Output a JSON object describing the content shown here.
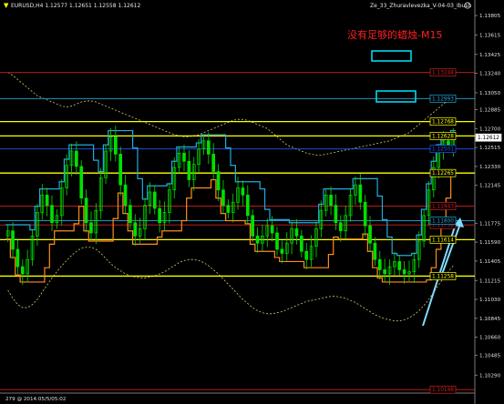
{
  "header": {
    "symbol_label": "EURUSD,H4  1.12577 1.12651 1.12558 1.12612",
    "indicator_label": "Ze_33_Zhuravlevezka_V-04-03_Ibush",
    "subtitle": "没有足够的蜡烛-M15",
    "bottom_label": "279 @ 2014.05/5/05:02"
  },
  "colors": {
    "background": "#000000",
    "candle": "#00e000",
    "red_line": "#d02020",
    "yellow_line": "#ffff00",
    "cyan_line": "#22aadd",
    "orange_line": "#ff8c1a",
    "envelope": "#cccc66",
    "arrow": "#7fdcff",
    "box": "#00e5ff"
  },
  "chart_data": {
    "type": "candlestick",
    "symbol": "EURUSD",
    "timeframe": "H4",
    "last": {
      "open": 1.12577,
      "high": 1.12651,
      "low": 1.12558,
      "close": 1.12612
    },
    "ylim": [
      1.1015,
      1.1385
    ],
    "y_ticks": [
      1.13805,
      1.13615,
      1.13425,
      1.1324,
      1.1305,
      1.12885,
      1.127,
      1.12515,
      1.1233,
      1.12145,
      1.11775,
      1.1159,
      1.11405,
      1.11215,
      1.1103,
      1.10845,
      1.1066,
      1.10485,
      1.1029
    ],
    "levels": [
      {
        "label": "1.13248",
        "value": 1.13248,
        "color": "#d02020",
        "style": "solid"
      },
      {
        "label": "1.12993",
        "value": 1.12993,
        "color": "#22aadd",
        "style": "solid"
      },
      {
        "label": "1.12768",
        "value": 1.12768,
        "color": "#ffff00",
        "style": "solid"
      },
      {
        "label": "1.12628",
        "value": 1.12628,
        "color": "#ffff00",
        "style": "solid"
      },
      {
        "label": "1.12612",
        "value": 1.12612,
        "color": "#ffffff",
        "style": "current"
      },
      {
        "label": "1.12501",
        "value": 1.12501,
        "color": "#2255ff",
        "style": "solid"
      },
      {
        "label": "1.12265",
        "value": 1.12265,
        "color": "#ffff00",
        "style": "solid"
      },
      {
        "label": "1.11943",
        "value": 1.11943,
        "color": "#d02020",
        "style": "solid"
      },
      {
        "label": "1.11758",
        "value": 1.11758,
        "color": "#d02020",
        "style": "solid"
      },
      {
        "label": "1.11614",
        "value": 1.11614,
        "color": "#ffff00",
        "style": "solid"
      },
      {
        "label": "1.11800",
        "value": 1.118,
        "color": "#22aadd",
        "style": "solid"
      },
      {
        "label": "1.11258",
        "value": 1.11258,
        "color": "#ffff00",
        "style": "solid"
      },
      {
        "label": "1.10148",
        "value": 1.10148,
        "color": "#d02020",
        "style": "solid"
      }
    ],
    "closes": [
      1.117,
      1.1152,
      1.1135,
      1.1128,
      1.1142,
      1.1165,
      1.1188,
      1.1205,
      1.1195,
      1.1178,
      1.1185,
      1.1212,
      1.1234,
      1.1248,
      1.1233,
      1.1202,
      1.1178,
      1.1168,
      1.119,
      1.1222,
      1.1248,
      1.1262,
      1.1245,
      1.1215,
      1.1195,
      1.1178,
      1.1165,
      1.1172,
      1.1195,
      1.1208,
      1.1192,
      1.1178,
      1.1188,
      1.121,
      1.1232,
      1.1246,
      1.1238,
      1.122,
      1.1235,
      1.125,
      1.1258,
      1.1245,
      1.1228,
      1.121,
      1.1195,
      1.1188,
      1.1198,
      1.1212,
      1.1205,
      1.1185,
      1.1165,
      1.1158,
      1.1165,
      1.1175,
      1.1168,
      1.1152,
      1.1148,
      1.1158,
      1.1172,
      1.1165,
      1.115,
      1.1142,
      1.1155,
      1.1172,
      1.119,
      1.1205,
      1.1195,
      1.1178,
      1.117,
      1.1185,
      1.1205,
      1.1215,
      1.1198,
      1.1175,
      1.1158,
      1.1142,
      1.1132,
      1.1128,
      1.1135,
      1.114,
      1.1132,
      1.1128,
      1.113,
      1.1142,
      1.116,
      1.1185,
      1.121,
      1.1232,
      1.1248,
      1.1258,
      1.1252,
      1.1262
    ],
    "upper_envelope": [
      1.1325,
      1.1322,
      1.1318,
      1.1314,
      1.131,
      1.1306,
      1.1302,
      1.13,
      1.1298,
      1.1296,
      1.1294,
      1.1292,
      1.1291,
      1.1292,
      1.1294,
      1.1296,
      1.1297,
      1.1297,
      1.1296,
      1.1294,
      1.1292,
      1.129,
      1.1288,
      1.1286,
      1.1284,
      1.1282,
      1.128,
      1.1278,
      1.1276,
      1.1274,
      1.1272,
      1.127,
      1.1268,
      1.1266,
      1.1264,
      1.1263,
      1.1262,
      1.1262,
      1.1263,
      1.1264,
      1.1266,
      1.1268,
      1.127,
      1.1272,
      1.1274,
      1.1276,
      1.1278,
      1.1279,
      1.1279,
      1.1278,
      1.1276,
      1.1274,
      1.1272,
      1.127,
      1.1266,
      1.1262,
      1.1258,
      1.1254,
      1.1252,
      1.125,
      1.1248,
      1.1246,
      1.1245,
      1.1244,
      1.1244,
      1.1245,
      1.1246,
      1.1247,
      1.1248,
      1.1249,
      1.125,
      1.1251,
      1.1252,
      1.1253,
      1.1254,
      1.1255,
      1.1256,
      1.1257,
      1.1258,
      1.126,
      1.1262,
      1.1264,
      1.1266,
      1.127,
      1.1274,
      1.1278,
      1.1282,
      1.1286,
      1.129,
      1.1294,
      1.1298,
      1.1302
    ],
    "lower_envelope": [
      1.1112,
      1.1104,
      1.1098,
      1.1095,
      1.1095,
      1.1098,
      1.1103,
      1.111,
      1.1117,
      1.1124,
      1.113,
      1.1136,
      1.1141,
      1.1146,
      1.115,
      1.1153,
      1.1154,
      1.1154,
      1.1152,
      1.1148,
      1.1143,
      1.1138,
      1.1134,
      1.1131,
      1.1128,
      1.1126,
      1.1125,
      1.1124,
      1.1124,
      1.1125,
      1.1126,
      1.1128,
      1.113,
      1.1133,
      1.1136,
      1.1139,
      1.1141,
      1.1142,
      1.1142,
      1.1141,
      1.1139,
      1.1136,
      1.1132,
      1.1128,
      1.1123,
      1.1118,
      1.1113,
      1.1108,
      1.1103,
      1.1099,
      1.1095,
      1.1092,
      1.109,
      1.1089,
      1.1089,
      1.109,
      1.1091,
      1.1093,
      1.1095,
      1.1097,
      1.1099,
      1.1101,
      1.1102,
      1.1103,
      1.1104,
      1.1105,
      1.1106,
      1.1106,
      1.1105,
      1.1104,
      1.1102,
      1.11,
      1.1097,
      1.1094,
      1.1091,
      1.1088,
      1.1086,
      1.1084,
      1.1083,
      1.1082,
      1.1082,
      1.1083,
      1.1085,
      1.1088,
      1.1092,
      1.1097,
      1.1103,
      1.111,
      1.1117,
      1.1124,
      1.113,
      1.1136
    ]
  }
}
